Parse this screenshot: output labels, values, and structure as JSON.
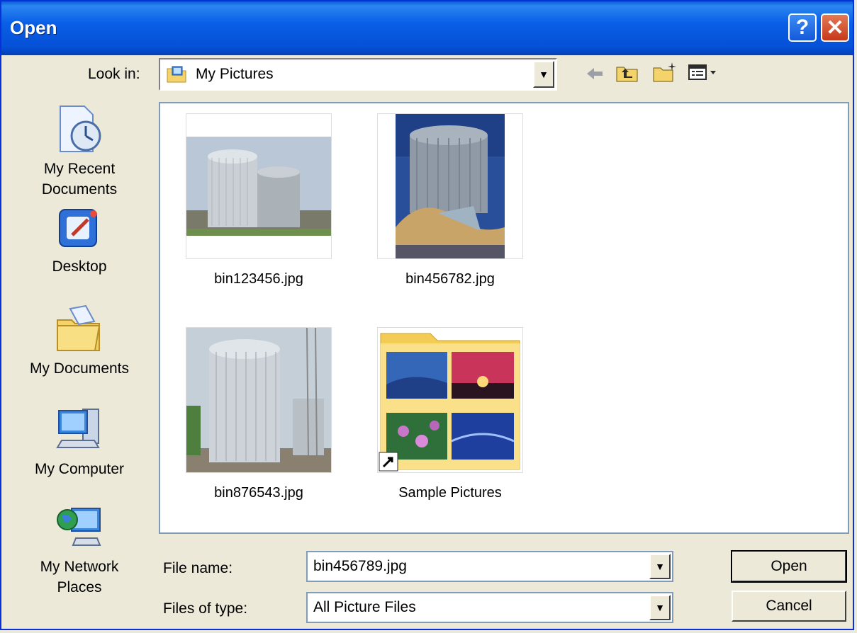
{
  "window": {
    "title": "Open",
    "help_glyph": "?",
    "close_glyph": "✕"
  },
  "toolbar": {
    "look_in_label": "Look in:",
    "look_in_value": "My Pictures",
    "icons": [
      "back-arrow-icon",
      "up-folder-icon",
      "new-folder-icon",
      "view-menu-icon"
    ]
  },
  "places": [
    {
      "label": "My Recent Documents",
      "line1": "My Recent",
      "line2": "Documents",
      "icon": "recent-documents-icon"
    },
    {
      "label": "Desktop",
      "line1": "Desktop",
      "line2": "",
      "icon": "desktop-icon"
    },
    {
      "label": "My Documents",
      "line1": "My Documents",
      "line2": "",
      "icon": "my-documents-icon"
    },
    {
      "label": "My Computer",
      "line1": "My Computer",
      "line2": "",
      "icon": "my-computer-icon"
    },
    {
      "label": "My Network Places",
      "line1": "My Network",
      "line2": "Places",
      "icon": "network-places-icon"
    }
  ],
  "files": [
    {
      "name": "bin123456.jpg",
      "kind": "image"
    },
    {
      "name": "bin456782.jpg",
      "kind": "image"
    },
    {
      "name": "bin876543.jpg",
      "kind": "image"
    },
    {
      "name": "Sample Pictures",
      "kind": "folder-shortcut"
    }
  ],
  "form": {
    "file_name_label": "File name:",
    "file_name_value": "bin456789.jpg",
    "file_type_label": "Files of type:",
    "file_type_value": "All Picture Files"
  },
  "buttons": {
    "open": "Open",
    "cancel": "Cancel"
  },
  "colors": {
    "title_bar": "#0a5fe6",
    "dialog_bg": "#ece9d8",
    "list_border": "#7f9db9"
  }
}
